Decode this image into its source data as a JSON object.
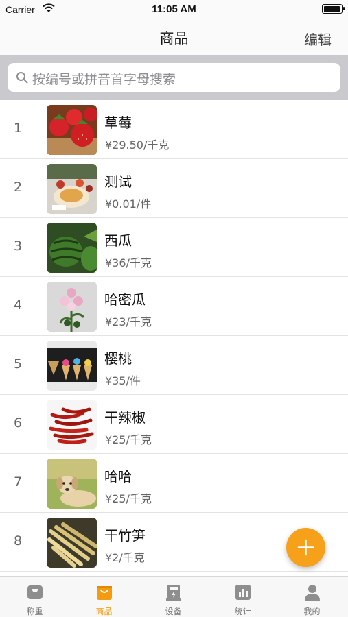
{
  "status_bar": {
    "carrier": "Carrier",
    "time": "11:05 AM"
  },
  "nav": {
    "title": "商品",
    "edit_label": "编辑"
  },
  "search": {
    "placeholder": "按编号或拼音首字母搜索"
  },
  "products": [
    {
      "index": "1",
      "name": "草莓",
      "price": "¥29.50/千克",
      "image": "strawberries"
    },
    {
      "index": "2",
      "name": "测试",
      "price": "¥0.01/件",
      "image": "food-plates"
    },
    {
      "index": "3",
      "name": "西瓜",
      "price": "¥36/千克",
      "image": "watermelons"
    },
    {
      "index": "4",
      "name": "哈密瓜",
      "price": "¥23/千克",
      "image": "flowers"
    },
    {
      "index": "5",
      "name": "樱桃",
      "price": "¥35/件",
      "image": "ice-cream-cones"
    },
    {
      "index": "6",
      "name": "干辣椒",
      "price": "¥25/千克",
      "image": "dried-chilies"
    },
    {
      "index": "7",
      "name": "哈哈",
      "price": "¥25/千克",
      "image": "dog"
    },
    {
      "index": "8",
      "name": "干竹笋",
      "price": "¥2/千克",
      "image": "dried-bamboo-shoots"
    }
  ],
  "fab": {
    "icon": "plus-icon"
  },
  "tabs": [
    {
      "label": "称重",
      "icon": "scale-icon",
      "active": false
    },
    {
      "label": "商品",
      "icon": "bag-icon",
      "active": true
    },
    {
      "label": "设备",
      "icon": "device-icon",
      "active": false
    },
    {
      "label": "统计",
      "icon": "chart-icon",
      "active": false
    },
    {
      "label": "我的",
      "icon": "person-icon",
      "active": false
    }
  ],
  "colors": {
    "accent": "#f7a11a",
    "tab_active": "#f39c12",
    "search_bg": "#c9c9ce"
  }
}
